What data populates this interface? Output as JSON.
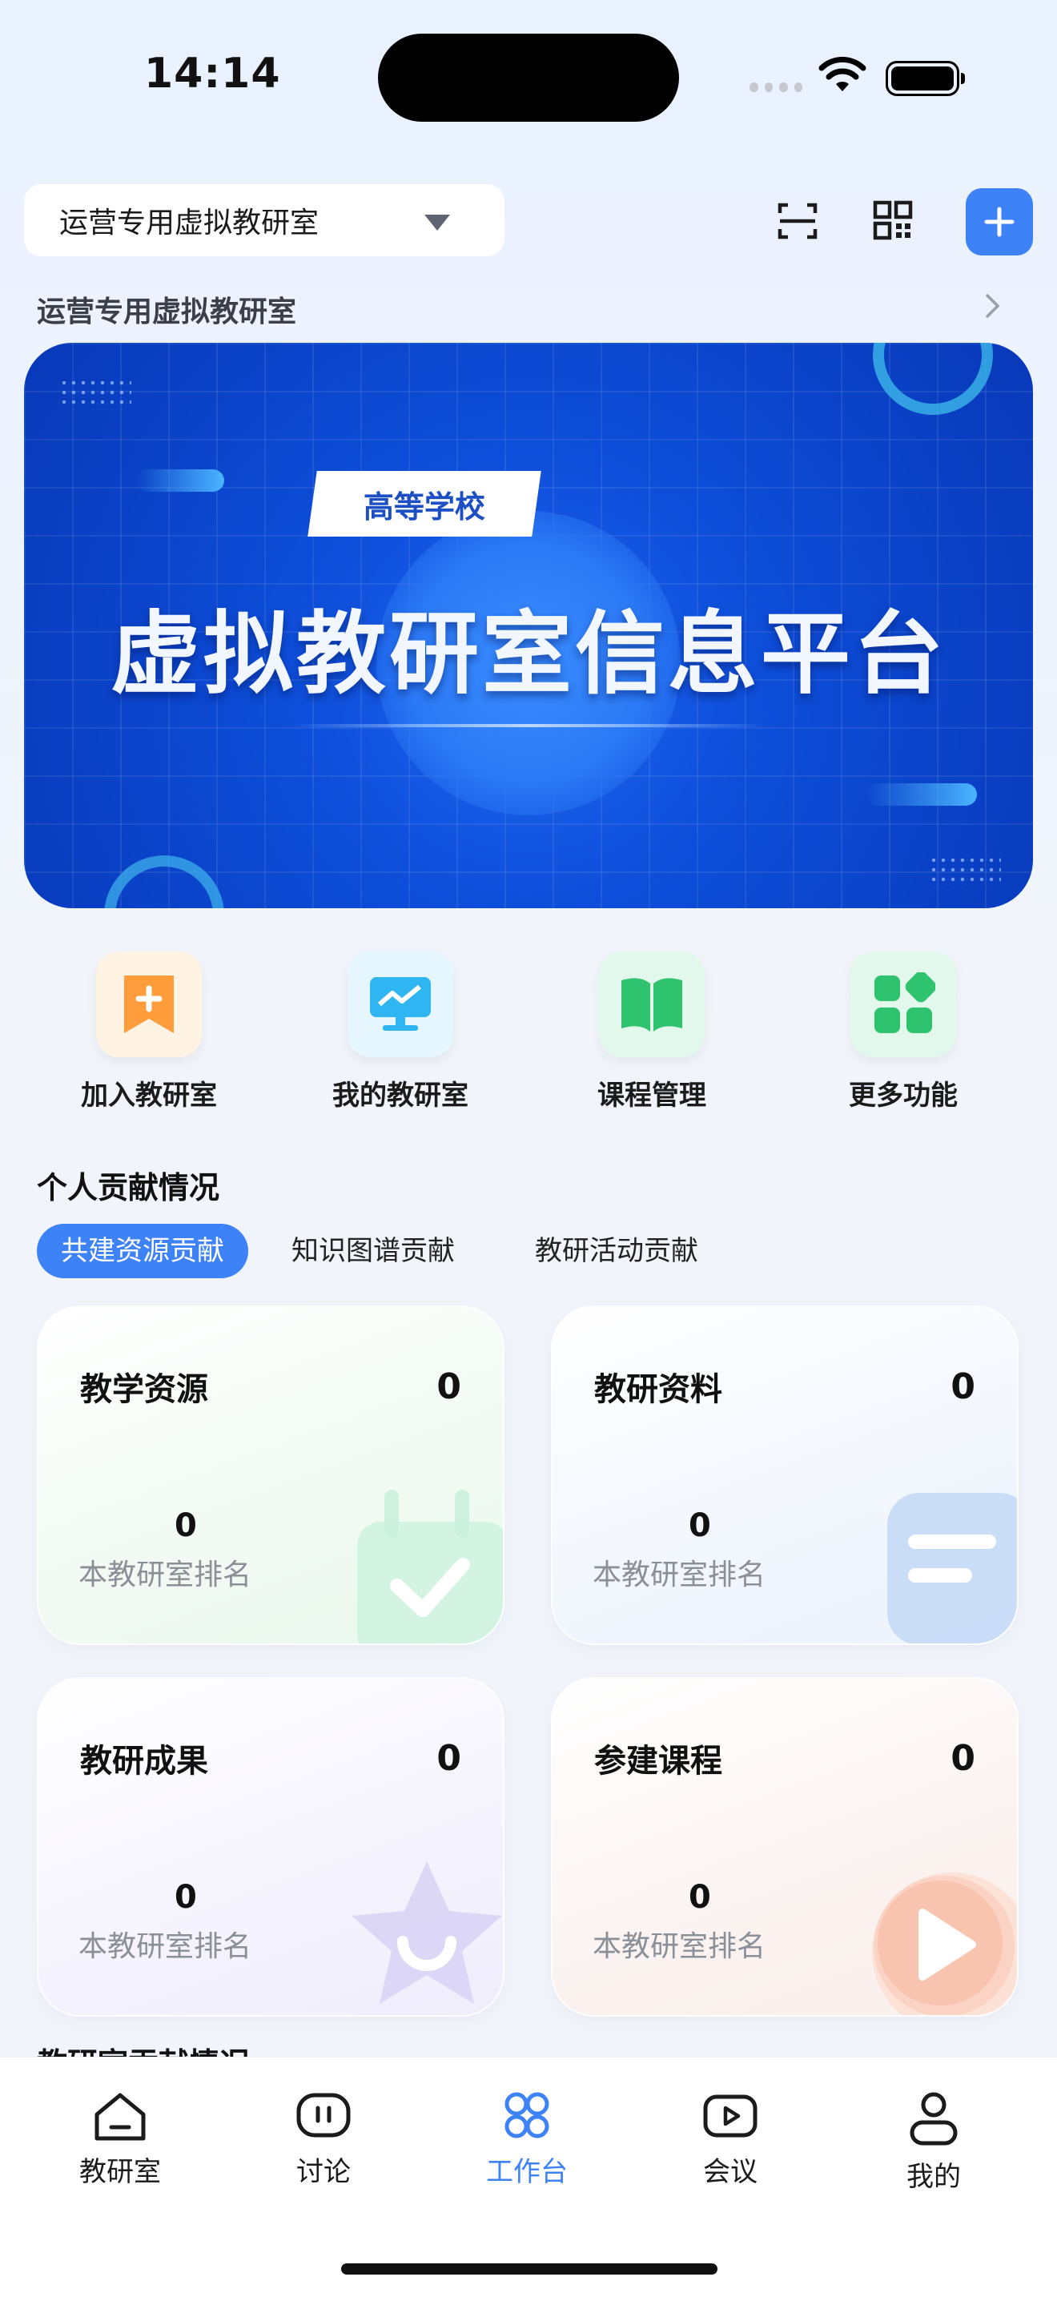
{
  "status_bar": {
    "time": "14:14"
  },
  "header": {
    "selector_label": "运营专用虚拟教研室",
    "subtitle": "运营专用虚拟教研室"
  },
  "banner": {
    "tag": "高等学校",
    "title": "虚拟教研室信息平台"
  },
  "quick_actions": [
    {
      "label": "加入教研室",
      "icon": "bookmark-plus-icon",
      "color": "#ff9d3c"
    },
    {
      "label": "我的教研室",
      "icon": "monitor-chart-icon",
      "color": "#2fb6f2"
    },
    {
      "label": "课程管理",
      "icon": "open-book-icon",
      "color": "#2fc26f"
    },
    {
      "label": "更多功能",
      "icon": "apps-grid-icon",
      "color": "#2fc26f"
    }
  ],
  "contribution": {
    "section_title": "个人贡献情况",
    "tabs": [
      "共建资源贡献",
      "知识图谱贡献",
      "教研活动贡献"
    ],
    "active_tab": 0,
    "cards": [
      {
        "title": "教学资源",
        "value": "0",
        "rank_value": "0",
        "rank_label": "本教研室排名"
      },
      {
        "title": "教研资料",
        "value": "0",
        "rank_value": "0",
        "rank_label": "本教研室排名"
      },
      {
        "title": "教研成果",
        "value": "0",
        "rank_value": "0",
        "rank_label": "本教研室排名"
      },
      {
        "title": "参建课程",
        "value": "0",
        "rank_value": "0",
        "rank_label": "本教研室排名"
      }
    ]
  },
  "next_section_peek": "教研室贡献情况",
  "tab_bar": {
    "items": [
      {
        "label": "教研室",
        "icon": "home-icon"
      },
      {
        "label": "讨论",
        "icon": "chat-icon"
      },
      {
        "label": "工作台",
        "icon": "workbench-icon"
      },
      {
        "label": "会议",
        "icon": "video-icon"
      },
      {
        "label": "我的",
        "icon": "person-icon"
      }
    ],
    "active_index": 2,
    "active_color": "#3e82f7"
  }
}
